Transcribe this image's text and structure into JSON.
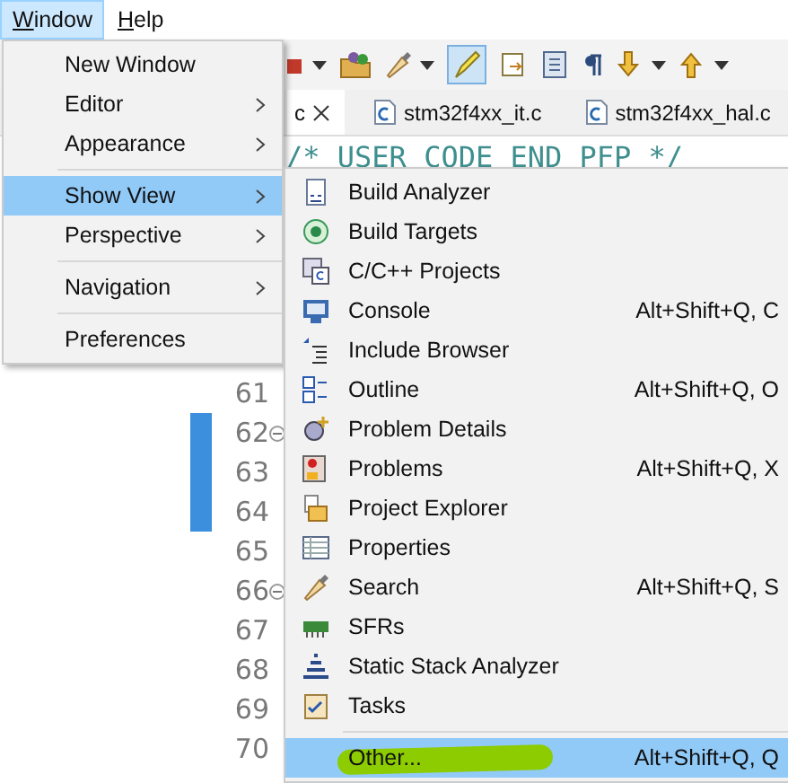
{
  "menubar": [
    {
      "label": "Window",
      "selected": true
    },
    {
      "label": "Help",
      "selected": false
    }
  ],
  "toolbar": {
    "highlight_toggle_on": true
  },
  "tabs": [
    {
      "label": "c",
      "selected": true,
      "closable": true
    },
    {
      "label": "stm32f4xx_it.c",
      "selected": false,
      "closable": false
    },
    {
      "label": "stm32f4xx_hal.c",
      "selected": false,
      "closable": false
    }
  ],
  "editor": {
    "code": "/* USER CODE END PFP */",
    "lines": [
      {
        "number": "61",
        "folded": false,
        "changed": false
      },
      {
        "number": "62",
        "folded": true,
        "changed": true
      },
      {
        "number": "63",
        "folded": false,
        "changed": true
      },
      {
        "number": "64",
        "folded": false,
        "changed": true
      },
      {
        "number": "65",
        "folded": false,
        "changed": false
      },
      {
        "number": "66",
        "folded": true,
        "changed": false
      },
      {
        "number": "67",
        "folded": false,
        "changed": false
      },
      {
        "number": "68",
        "folded": false,
        "changed": false
      },
      {
        "number": "69",
        "folded": false,
        "changed": false
      },
      {
        "number": "70",
        "folded": false,
        "changed": false
      }
    ]
  },
  "window_menu": [
    {
      "kind": "item",
      "label": "New Window",
      "submenu": false,
      "selected": false
    },
    {
      "kind": "item",
      "label": "Editor",
      "submenu": true,
      "selected": false
    },
    {
      "kind": "item",
      "label": "Appearance",
      "submenu": true,
      "selected": false
    },
    {
      "kind": "separator"
    },
    {
      "kind": "item",
      "label": "Show View",
      "submenu": true,
      "selected": true
    },
    {
      "kind": "item",
      "label": "Perspective",
      "submenu": true,
      "selected": false
    },
    {
      "kind": "separator"
    },
    {
      "kind": "item",
      "label": "Navigation",
      "submenu": true,
      "selected": false
    },
    {
      "kind": "separator"
    },
    {
      "kind": "item",
      "label": "Preferences",
      "submenu": false,
      "selected": false
    }
  ],
  "show_view_menu": [
    {
      "kind": "item",
      "label": "Build Analyzer",
      "selected": false
    },
    {
      "kind": "item",
      "label": "Build Targets",
      "selected": false
    },
    {
      "kind": "item",
      "label": "C/C++ Projects",
      "selected": false
    },
    {
      "kind": "item",
      "label": "Console",
      "shortcut": "Alt+Shift+Q, C",
      "selected": false
    },
    {
      "kind": "item",
      "label": "Include Browser",
      "selected": false
    },
    {
      "kind": "item",
      "label": "Outline",
      "shortcut": "Alt+Shift+Q, O",
      "selected": false
    },
    {
      "kind": "item",
      "label": "Problem Details",
      "selected": false
    },
    {
      "kind": "item",
      "label": "Problems",
      "shortcut": "Alt+Shift+Q, X",
      "selected": false
    },
    {
      "kind": "item",
      "label": "Project Explorer",
      "selected": false
    },
    {
      "kind": "item",
      "label": "Properties",
      "selected": false
    },
    {
      "kind": "item",
      "label": "Search",
      "shortcut": "Alt+Shift+Q, S",
      "selected": false
    },
    {
      "kind": "item",
      "label": "SFRs",
      "selected": false
    },
    {
      "kind": "item",
      "label": "Static Stack Analyzer",
      "selected": false
    },
    {
      "kind": "item",
      "label": "Tasks",
      "selected": false
    },
    {
      "kind": "separator"
    },
    {
      "kind": "item",
      "label": "Other...",
      "shortcut": "Alt+Shift+Q, Q",
      "selected": true,
      "marked": true
    }
  ]
}
